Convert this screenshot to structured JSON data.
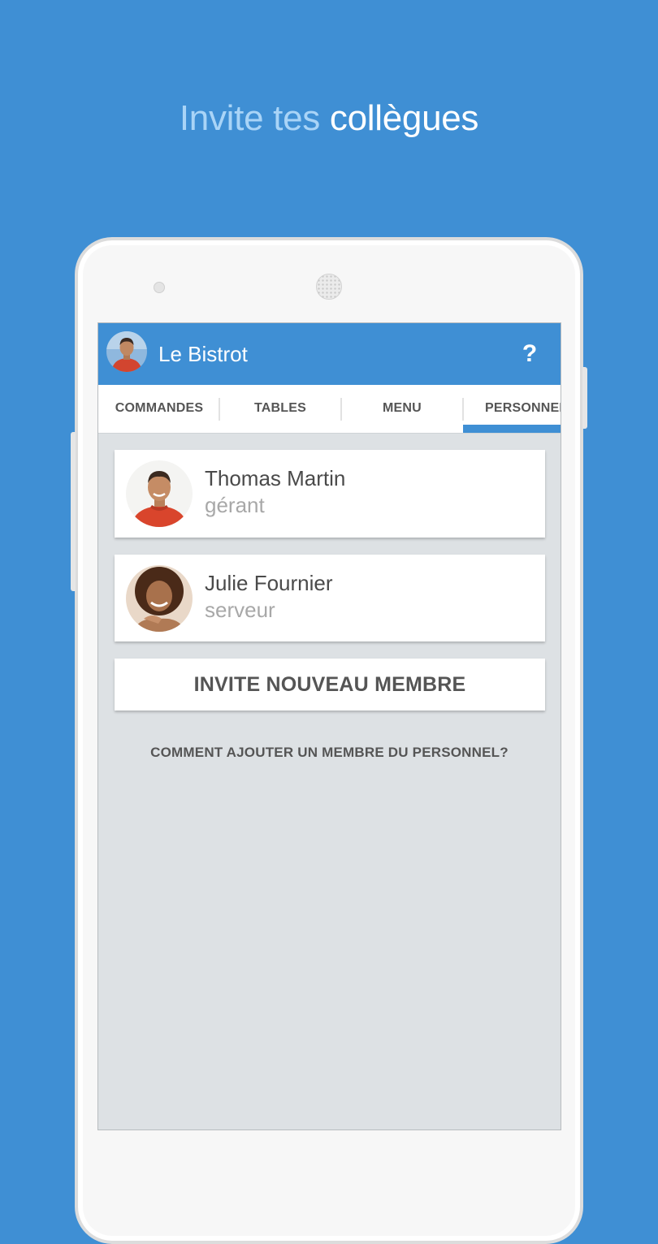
{
  "headline": {
    "light": "Invite tes",
    "bold": "collègues"
  },
  "app": {
    "title": "Le Bistrot",
    "help_label": "?"
  },
  "tabs": [
    {
      "label": "COMMANDES",
      "active": false
    },
    {
      "label": "TABLES",
      "active": false
    },
    {
      "label": "MENU",
      "active": false
    },
    {
      "label": "PERSONNEL",
      "active": true
    }
  ],
  "staff": [
    {
      "name": "Thomas Martin",
      "role": "gérant"
    },
    {
      "name": "Julie Fournier",
      "role": "serveur"
    }
  ],
  "invite_button": "INVITE NOUVEAU MEMBRE",
  "help_link": "COMMENT AJOUTER UN MEMBRE DU PERSONNEL?",
  "colors": {
    "background": "#3f8fd4",
    "appbar": "#3f8fd4",
    "screen_bg": "#dde1e4",
    "active_tab_indicator": "#3f8fd4"
  }
}
